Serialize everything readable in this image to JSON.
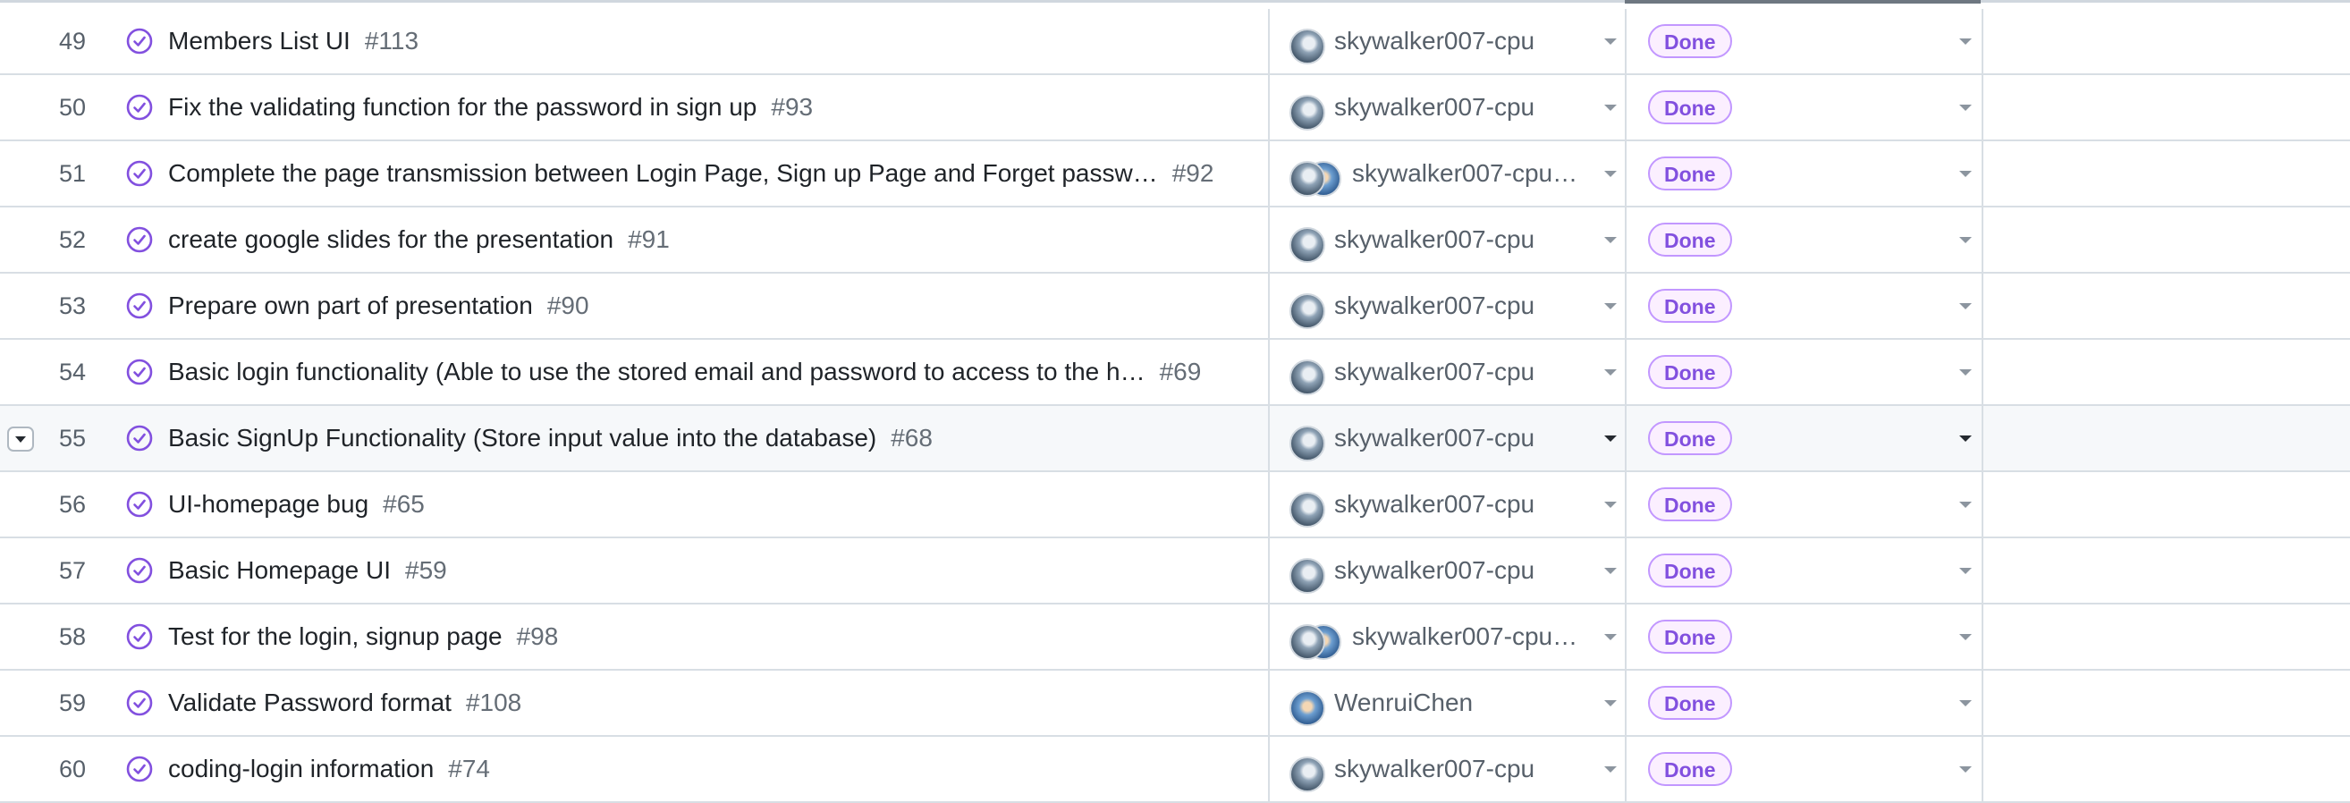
{
  "colors": {
    "done_purple": "#8250df",
    "badge_bg": "#fbefff",
    "badge_border": "#c297ff"
  },
  "rows": [
    {
      "number": "49",
      "title": "Members List UI",
      "issue": "#113",
      "assignee": "skywalker007-cpu",
      "assignee_avatars": [
        "sky"
      ],
      "status": "Done"
    },
    {
      "number": "50",
      "title": "Fix the validating function for the password in sign up",
      "issue": "#93",
      "assignee": "skywalker007-cpu",
      "assignee_avatars": [
        "sky"
      ],
      "status": "Done"
    },
    {
      "number": "51",
      "title": "Complete the page transmission between Login Page, Sign up Page and Forget passw…",
      "issue": "#92",
      "assignee": "skywalker007-cpu…",
      "assignee_avatars": [
        "sky",
        "wenrui"
      ],
      "status": "Done"
    },
    {
      "number": "52",
      "title": "create google slides for the presentation",
      "issue": "#91",
      "assignee": "skywalker007-cpu",
      "assignee_avatars": [
        "sky"
      ],
      "status": "Done"
    },
    {
      "number": "53",
      "title": "Prepare own part of presentation",
      "issue": "#90",
      "assignee": "skywalker007-cpu",
      "assignee_avatars": [
        "sky"
      ],
      "status": "Done"
    },
    {
      "number": "54",
      "title": "Basic login functionality (Able to use the stored email and password to access to the h…",
      "issue": "#69",
      "assignee": "skywalker007-cpu",
      "assignee_avatars": [
        "sky"
      ],
      "status": "Done"
    },
    {
      "number": "55",
      "title": "Basic SignUp Functionality (Store input value into the database)",
      "issue": "#68",
      "assignee": "skywalker007-cpu",
      "assignee_avatars": [
        "sky"
      ],
      "status": "Done",
      "hovered": true
    },
    {
      "number": "56",
      "title": "UI-homepage bug",
      "issue": "#65",
      "assignee": "skywalker007-cpu",
      "assignee_avatars": [
        "sky"
      ],
      "status": "Done"
    },
    {
      "number": "57",
      "title": "Basic Homepage UI",
      "issue": "#59",
      "assignee": "skywalker007-cpu",
      "assignee_avatars": [
        "sky"
      ],
      "status": "Done"
    },
    {
      "number": "58",
      "title": "Test for the login, signup page",
      "issue": "#98",
      "assignee": "skywalker007-cpu…",
      "assignee_avatars": [
        "sky",
        "wenrui"
      ],
      "status": "Done"
    },
    {
      "number": "59",
      "title": "Validate Password format",
      "issue": "#108",
      "assignee": "WenruiChen",
      "assignee_avatars": [
        "wenrui"
      ],
      "status": "Done"
    },
    {
      "number": "60",
      "title": "coding-login information",
      "issue": "#74",
      "assignee": "skywalker007-cpu",
      "assignee_avatars": [
        "sky"
      ],
      "status": "Done"
    }
  ]
}
